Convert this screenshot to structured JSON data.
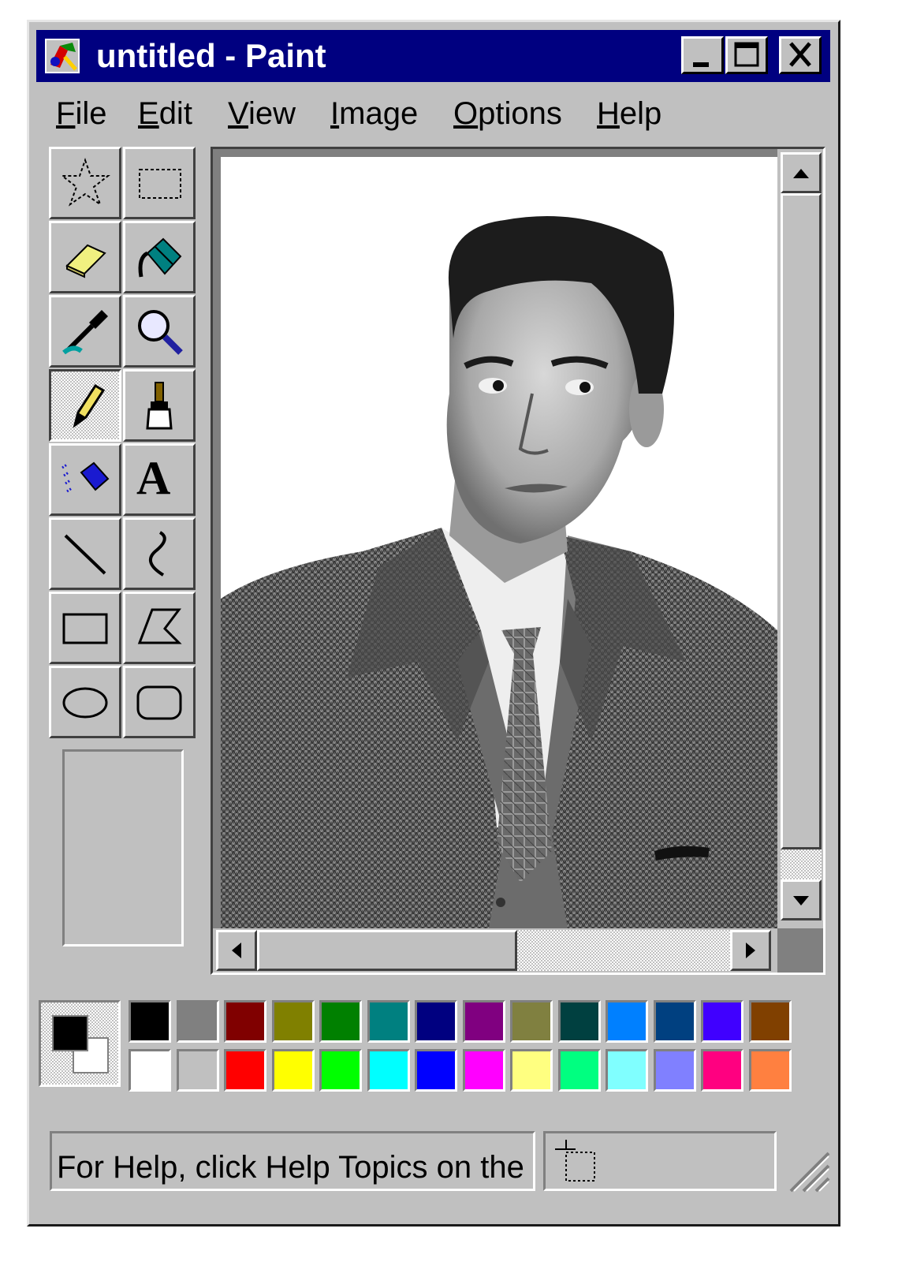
{
  "window": {
    "title": "untitled - Paint",
    "title_bar_color": "#000080",
    "icon": "paint-app-icon",
    "controls": [
      "minimize-icon",
      "maximize-icon",
      "close-icon"
    ]
  },
  "menu": {
    "items": [
      {
        "label": "File",
        "mnemonic": "F"
      },
      {
        "label": "Edit",
        "mnemonic": "E"
      },
      {
        "label": "View",
        "mnemonic": "V"
      },
      {
        "label": "Image",
        "mnemonic": "I"
      },
      {
        "label": "Options",
        "mnemonic": "O"
      },
      {
        "label": "Help",
        "mnemonic": "H"
      }
    ]
  },
  "tools": [
    {
      "name": "free-form-select",
      "icon": "star-select-icon"
    },
    {
      "name": "select",
      "icon": "rect-select-icon"
    },
    {
      "name": "eraser",
      "icon": "eraser-icon"
    },
    {
      "name": "fill-with-color",
      "icon": "paint-bucket-icon"
    },
    {
      "name": "pick-color",
      "icon": "eyedropper-icon"
    },
    {
      "name": "magnifier",
      "icon": "magnifier-icon"
    },
    {
      "name": "pencil",
      "icon": "pencil-icon",
      "active": true
    },
    {
      "name": "brush",
      "icon": "brush-icon"
    },
    {
      "name": "airbrush",
      "icon": "airbrush-icon"
    },
    {
      "name": "text",
      "icon": "text-icon"
    },
    {
      "name": "line",
      "icon": "line-icon"
    },
    {
      "name": "curve",
      "icon": "curve-icon"
    },
    {
      "name": "rectangle",
      "icon": "rectangle-icon"
    },
    {
      "name": "polygon",
      "icon": "polygon-icon"
    },
    {
      "name": "ellipse",
      "icon": "ellipse-icon"
    },
    {
      "name": "rounded-rectangle",
      "icon": "rounded-rectangle-icon"
    }
  ],
  "text_tool_glyph": "A",
  "canvas": {
    "content": "black-and-white portrait photograph of a man in a herringbone tweed jacket, white shirt and plaid tie"
  },
  "current_colors": {
    "foreground": "#000000",
    "background": "#ffffff"
  },
  "palette": {
    "top_row": [
      "#000000",
      "#808080",
      "#800000",
      "#808000",
      "#008000",
      "#008080",
      "#000080",
      "#800080",
      "#808040",
      "#004040",
      "#0080ff",
      "#004080",
      "#4000ff",
      "#804000"
    ],
    "bottom_row": [
      "#ffffff",
      "#c0c0c0",
      "#ff0000",
      "#ffff00",
      "#00ff00",
      "#00ffff",
      "#0000ff",
      "#ff00ff",
      "#ffff80",
      "#00ff80",
      "#80ffff",
      "#8080ff",
      "#ff0080",
      "#ff8040"
    ]
  },
  "status": {
    "text": "For Help, click Help Topics on the",
    "coord_icon": "selection-size-icon"
  }
}
